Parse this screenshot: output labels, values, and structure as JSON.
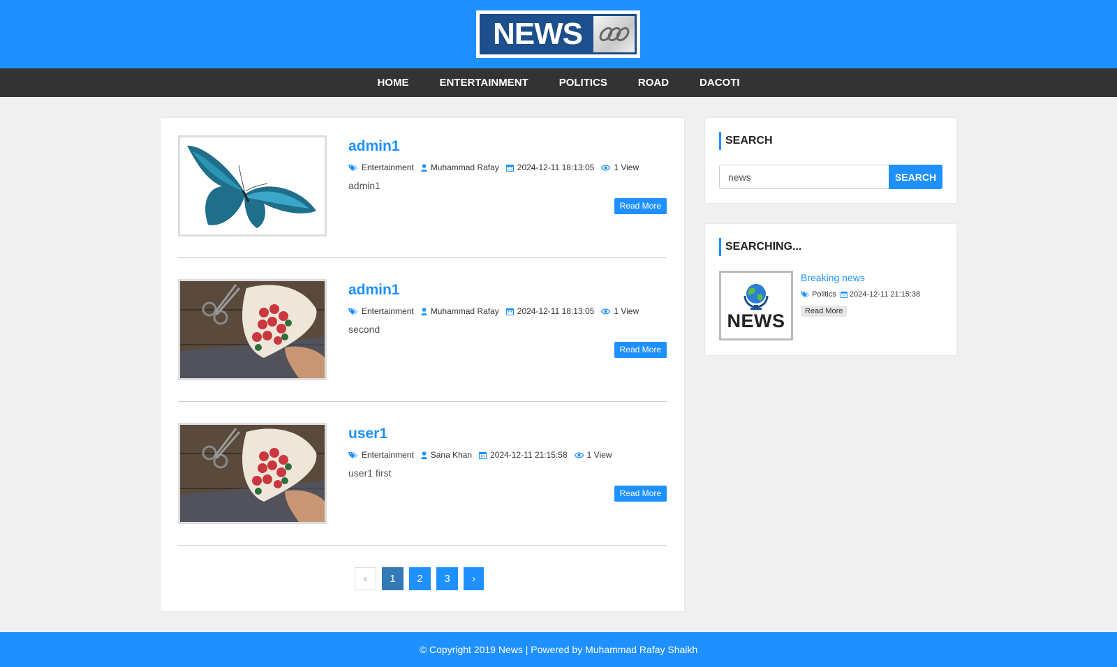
{
  "header": {
    "logo_text": "NEWS"
  },
  "nav": {
    "items": [
      "HOME",
      "ENTERTAINMENT",
      "POLITICS",
      "ROAD",
      "DACOTI"
    ]
  },
  "posts": [
    {
      "title": "admin1",
      "category": "Entertainment",
      "author": "Muhammad Rafay",
      "date": "2024-12-11 18:13:05",
      "views": "1 View",
      "excerpt": "admin1",
      "read_more": "Read More",
      "image": "butterfly"
    },
    {
      "title": "admin1",
      "category": "Entertainment",
      "author": "Muhammad Rafay",
      "date": "2024-12-11 18:13:05",
      "views": "1 View",
      "excerpt": "second",
      "read_more": "Read More",
      "image": "flower-bouquet"
    },
    {
      "title": "user1",
      "category": "Entertainment",
      "author": "Sana Khan",
      "date": "2024-12-11 21:15:58",
      "views": "1 View",
      "excerpt": "user1 first",
      "read_more": "Read More",
      "image": "flower-bouquet"
    }
  ],
  "pagination": {
    "prev": "‹",
    "pages": [
      "1",
      "2",
      "3"
    ],
    "active": "1",
    "next": "›"
  },
  "sidebar": {
    "search": {
      "title": "SEARCH",
      "value": "news",
      "button": "SEARCH"
    },
    "recent": {
      "title": "SEARCHING...",
      "thumb_text": "NEWS",
      "post_title": "Breaking news",
      "category": "Politics",
      "date": "2024-12-11 21:15:38",
      "read_more": "Read More"
    }
  },
  "footer": {
    "text": "© Copyright 2019 News | Powered by Muhammad Rafay Shaikh"
  },
  "colors": {
    "brand": "#1e90ff",
    "nav_bg": "#333333",
    "active_page": "#337ab7"
  }
}
